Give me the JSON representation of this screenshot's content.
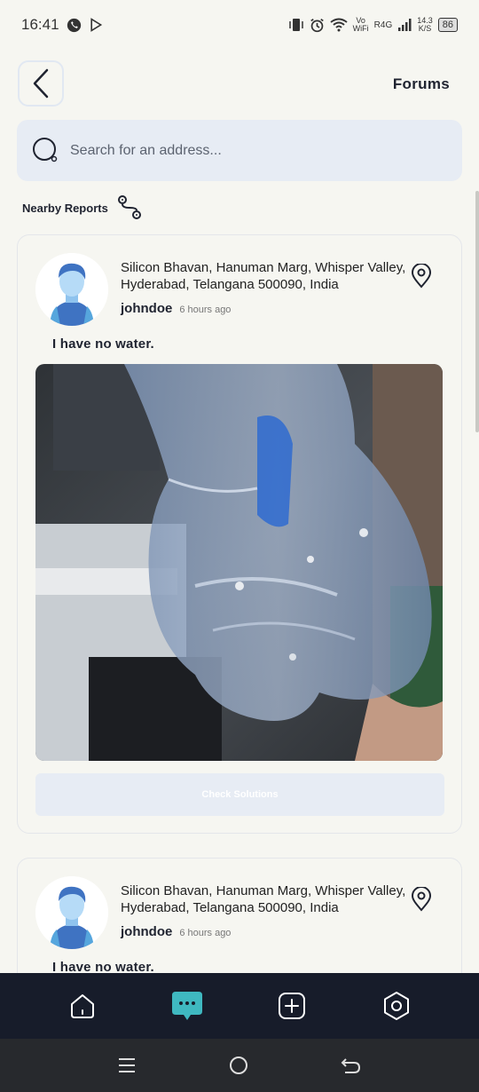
{
  "status_bar": {
    "time": "16:41",
    "network_top": "Vo",
    "network_bottom": "WiFi",
    "network_type": "R4G",
    "speed_value": "14.3",
    "speed_unit": "K/S",
    "battery": "86"
  },
  "header": {
    "title": "Forums",
    "back_icon": "chevron-left-icon"
  },
  "search": {
    "placeholder": "Search for an address..."
  },
  "nearby": {
    "label": "Nearby Reports",
    "icon": "route-icon"
  },
  "reports": [
    {
      "address": "Silicon Bhavan, Hanuman Marg, Whisper Valley, Hyderabad, Telangana 500090, India",
      "username": "johndoe",
      "time_ago": "6 hours ago",
      "text": "I have no water.",
      "button_label": "Check Solutions"
    },
    {
      "address": "Silicon Bhavan, Hanuman Marg, Whisper Valley, Hyderabad, Telangana 500090, India",
      "username": "johndoe",
      "time_ago": "6 hours ago",
      "text": "I have no water."
    }
  ],
  "bottom_nav": {
    "items": [
      "home-icon",
      "chat-icon",
      "add-icon",
      "settings-icon"
    ],
    "active": "chat-icon",
    "accent": "#3fb8c0"
  },
  "colors": {
    "background": "#f6f6f1",
    "search_bg": "#e7ecf4",
    "nav_bg": "#171c2a"
  }
}
